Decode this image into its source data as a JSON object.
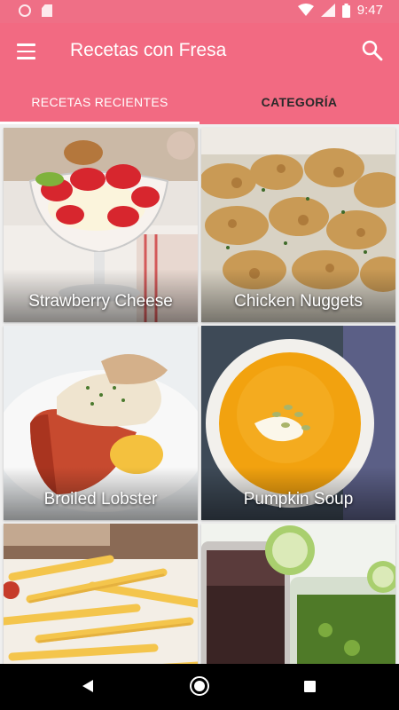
{
  "status_bar": {
    "time": "9:47",
    "icons": [
      "circle-icon",
      "sd-card-icon",
      "wifi-icon",
      "signal-icon",
      "battery-icon"
    ]
  },
  "app_bar": {
    "title": "Recetas con Fresa",
    "menu_icon": "hamburger-menu-icon",
    "search_icon": "search-icon",
    "color": "#f26a82"
  },
  "tabs": [
    {
      "label": "RECETAS RECIENTES",
      "active": true
    },
    {
      "label": "CATEGORÍA",
      "active": false
    }
  ],
  "recipes": [
    {
      "name": "Strawberry Cheese"
    },
    {
      "name": "Chicken Nuggets"
    },
    {
      "name": "Broiled Lobster"
    },
    {
      "name": "Pumpkin Soup"
    },
    {
      "name": ""
    },
    {
      "name": ""
    }
  ],
  "nav_bar": {
    "back_icon": "back-triangle-icon",
    "home_icon": "home-circle-icon",
    "recent_icon": "recent-apps-square-icon"
  }
}
